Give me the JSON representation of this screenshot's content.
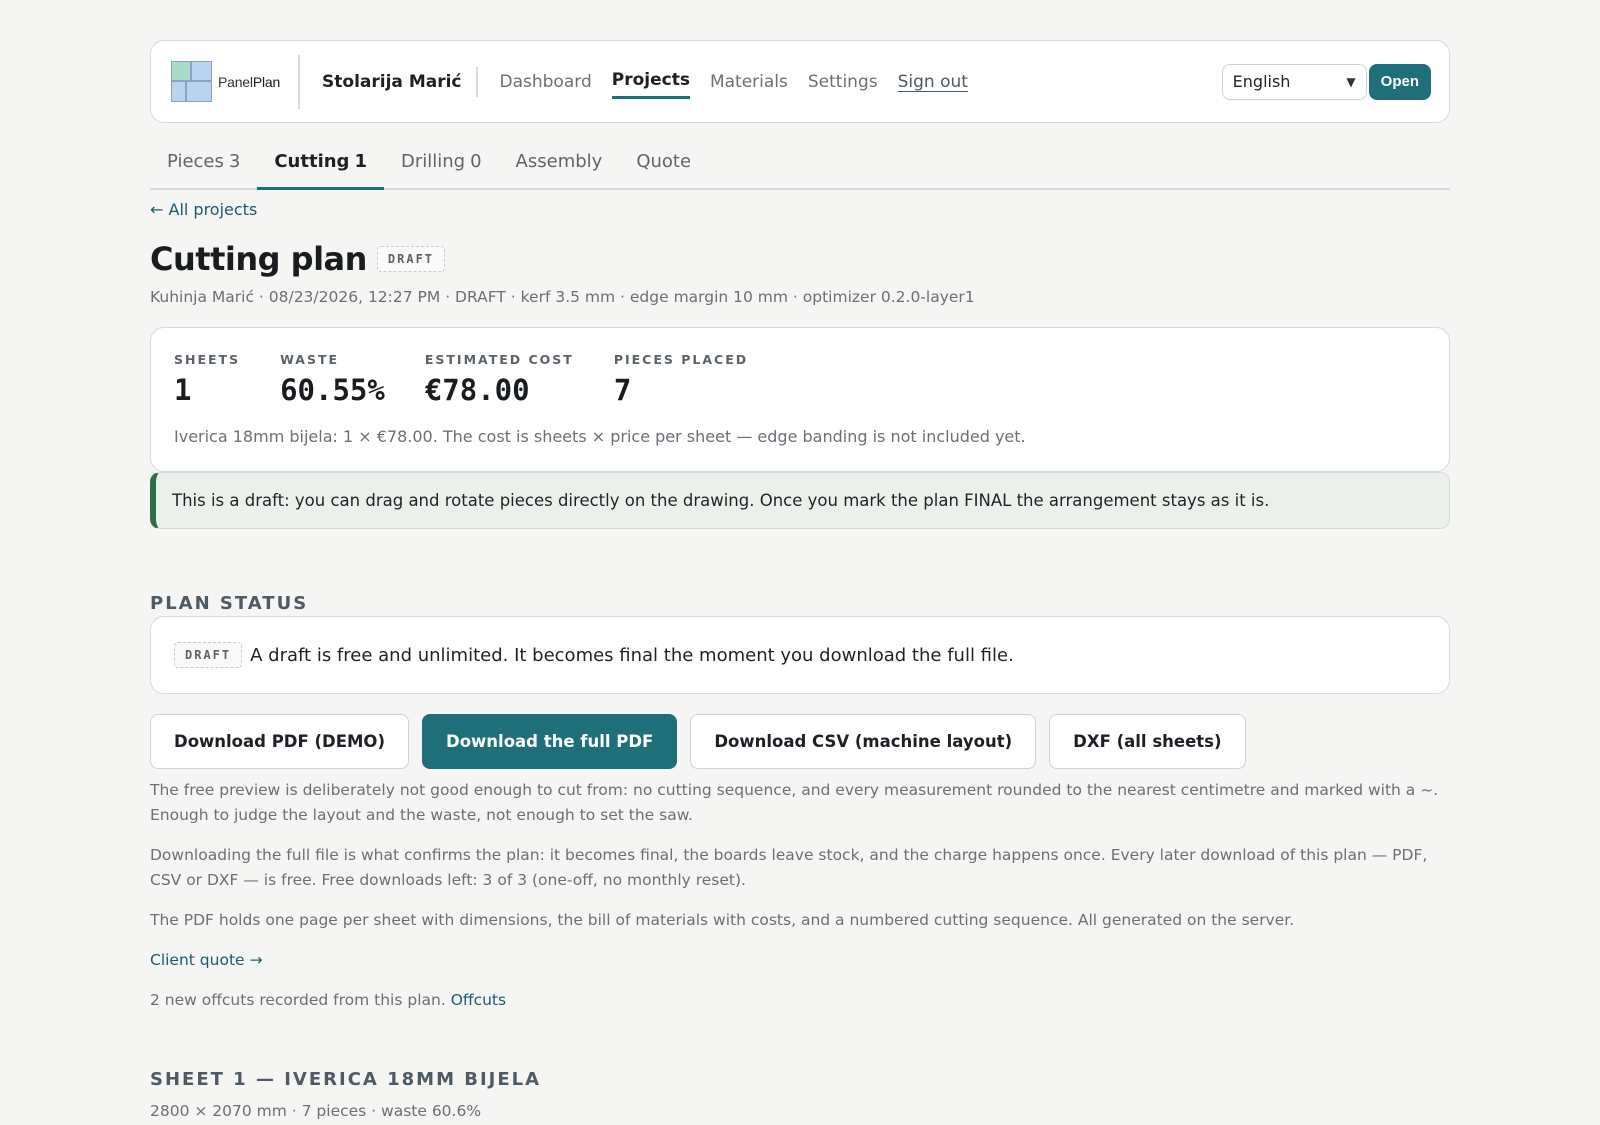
{
  "header": {
    "logo_prefix": "Panel",
    "logo_suffix": "Plan",
    "brand": "Stolarija Marić",
    "nav": [
      {
        "label": "Dashboard"
      },
      {
        "label": "Projects"
      },
      {
        "label": "Materials"
      },
      {
        "label": "Settings"
      },
      {
        "label": "Sign out"
      }
    ],
    "language_value": "English",
    "open_label": "Open"
  },
  "tabs": [
    {
      "label": "Pieces",
      "count": "3"
    },
    {
      "label": "Cutting",
      "count": "1"
    },
    {
      "label": "Drilling",
      "count": "0"
    },
    {
      "label": "Assembly",
      "count": ""
    },
    {
      "label": "Quote",
      "count": ""
    }
  ],
  "back_link": "← All projects",
  "page": {
    "title": "Cutting plan",
    "badge": "DRAFT",
    "meta": "Kuhinja Marić · 08/23/2026, 12:27 PM · DRAFT · kerf 3.5 mm · edge margin 10 mm · optimizer 0.2.0-layer1"
  },
  "stats": [
    {
      "label": "SHEETS",
      "value": "1"
    },
    {
      "label": "WASTE",
      "value": "60.55%"
    },
    {
      "label": "ESTIMATED COST",
      "value": "€78.00"
    },
    {
      "label": "PIECES PLACED",
      "value": "7"
    }
  ],
  "stats_note": "Iverica 18mm bijela: 1 × €78.00. The cost is sheets × price per sheet — edge banding is not included yet.",
  "draft_notice": "This is a draft: you can drag and rotate pieces directly on the drawing. Once you mark the plan FINAL the arrangement stays as it is.",
  "plan_status": {
    "heading": "PLAN STATUS",
    "badge": "DRAFT",
    "text": "A draft is free and unlimited. It becomes final the moment you download the full file."
  },
  "buttons": {
    "pdf_demo": "Download PDF (DEMO)",
    "pdf_full": "Download the full PDF",
    "csv": "Download CSV (machine layout)",
    "dxf": "DXF (all sheets)"
  },
  "paragraphs": {
    "preview": "The free preview is deliberately not good enough to cut from: no cutting sequence, and every measurement rounded to the nearest centimetre and marked with a ~. Enough to judge the layout and the waste, not enough to set the saw.",
    "confirm": "Downloading the full file is what confirms the plan: it becomes final, the boards leave stock, and the charge happens once. Every later download of this plan — PDF, CSV or DXF — is free. Free downloads left: 3 of 3 (one-off, no monthly reset).",
    "pdf_info": "The PDF holds one page per sheet with dimensions, the bill of materials with costs, and a numbered cutting sequence. All generated on the server."
  },
  "client_quote_link": "Client quote →",
  "offcuts": {
    "text": "2 new offcuts recorded from this plan.",
    "link": "Offcuts"
  },
  "sheet": {
    "heading": "SHEET 1 — IVERICA 18MM BIJELA",
    "meta": "2800 × 2070 mm · 7 pieces · waste 60.6%"
  },
  "colors": {
    "accent": "#1e6f79",
    "notice_border": "#2f6f45",
    "link": "#1e5a70"
  }
}
